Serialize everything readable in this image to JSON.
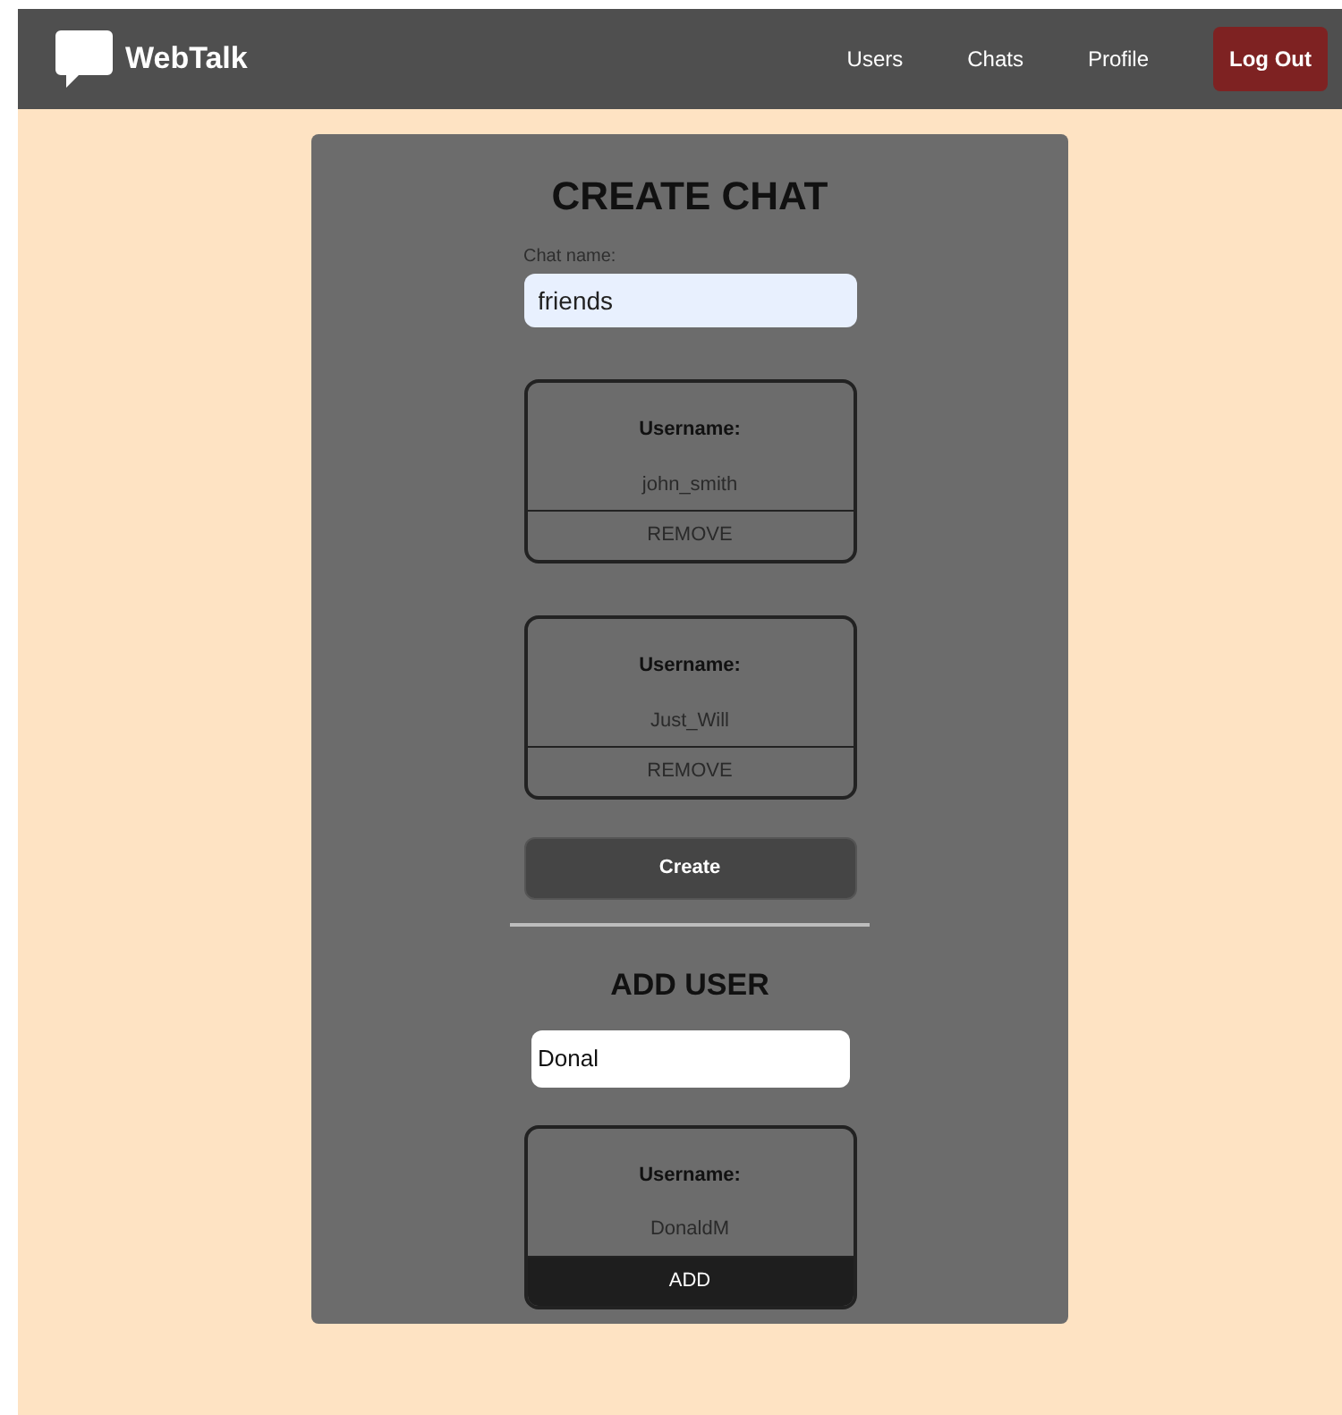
{
  "nav": {
    "brand": "WebTalk",
    "links": [
      {
        "label": "Users"
      },
      {
        "label": "Chats"
      },
      {
        "label": "Profile"
      }
    ],
    "logout": "Log Out"
  },
  "create_chat": {
    "title": "CREATE CHAT",
    "name_label": "Chat name:",
    "name_value": "friends",
    "members": [
      {
        "label": "Username:",
        "username": "john_smith",
        "action": "REMOVE",
        "hovered": false
      },
      {
        "label": "Username:",
        "username": "Just_Will",
        "action": "REMOVE",
        "hovered": false
      }
    ],
    "create_button": "Create"
  },
  "add_user": {
    "title": "ADD USER",
    "search_value": "Donal",
    "results": [
      {
        "label": "Username:",
        "username": "DonaldM",
        "action": "ADD",
        "hovered": true
      }
    ]
  }
}
